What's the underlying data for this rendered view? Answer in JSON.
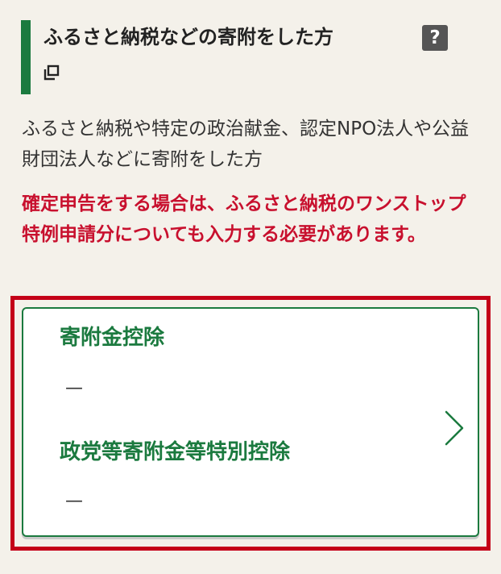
{
  "heading": {
    "title": "ふるさと納税などの寄附をした方",
    "help_icon_text": "?"
  },
  "description": "ふるさと納税や特定の政治献金、認定NPO法人や公益財団法人などに寄附をした方",
  "notice": "確定申告をする場合は、ふるさと納税のワンストップ特例申請分についても入力する必要があります。",
  "card": {
    "items": [
      {
        "label": "寄附金控除",
        "value": "—"
      },
      {
        "label": "政党等寄附金等特別控除",
        "value": "—"
      }
    ]
  },
  "colors": {
    "accent_green": "#1b7a3f",
    "notice_red": "#c8102e",
    "frame_red": "#c40018",
    "background": "#f4f1ea"
  },
  "icons": [
    "help-icon",
    "open-in-new-window-icon",
    "chevron-right-icon"
  ]
}
